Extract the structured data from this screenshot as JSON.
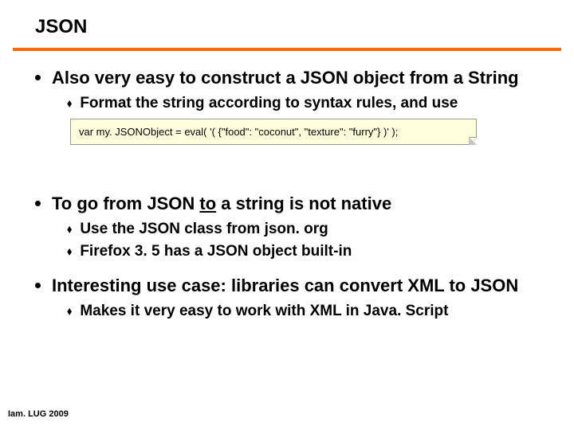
{
  "title": "JSON",
  "bullets": [
    {
      "text": "Also very easy to construct a JSON object from a String",
      "subs": [
        {
          "text": "Format the string according to syntax rules, and use"
        }
      ],
      "code": "var my. JSONObject = eval( '( {\"food\": \"coconut\", \"texture\": \"furry\"} )' );"
    },
    {
      "html": "To go from JSON <span class=\"underline\">to</span> a string is not native",
      "subs": [
        {
          "text": "Use the JSON class from json. org"
        },
        {
          "text": "Firefox 3. 5 has a JSON object built-in"
        }
      ]
    },
    {
      "text": "Interesting use case: libraries can convert XML to JSON",
      "subs": [
        {
          "text": "Makes it very easy to work with XML in Java. Script"
        }
      ]
    }
  ],
  "footer": "Iam. LUG 2009"
}
